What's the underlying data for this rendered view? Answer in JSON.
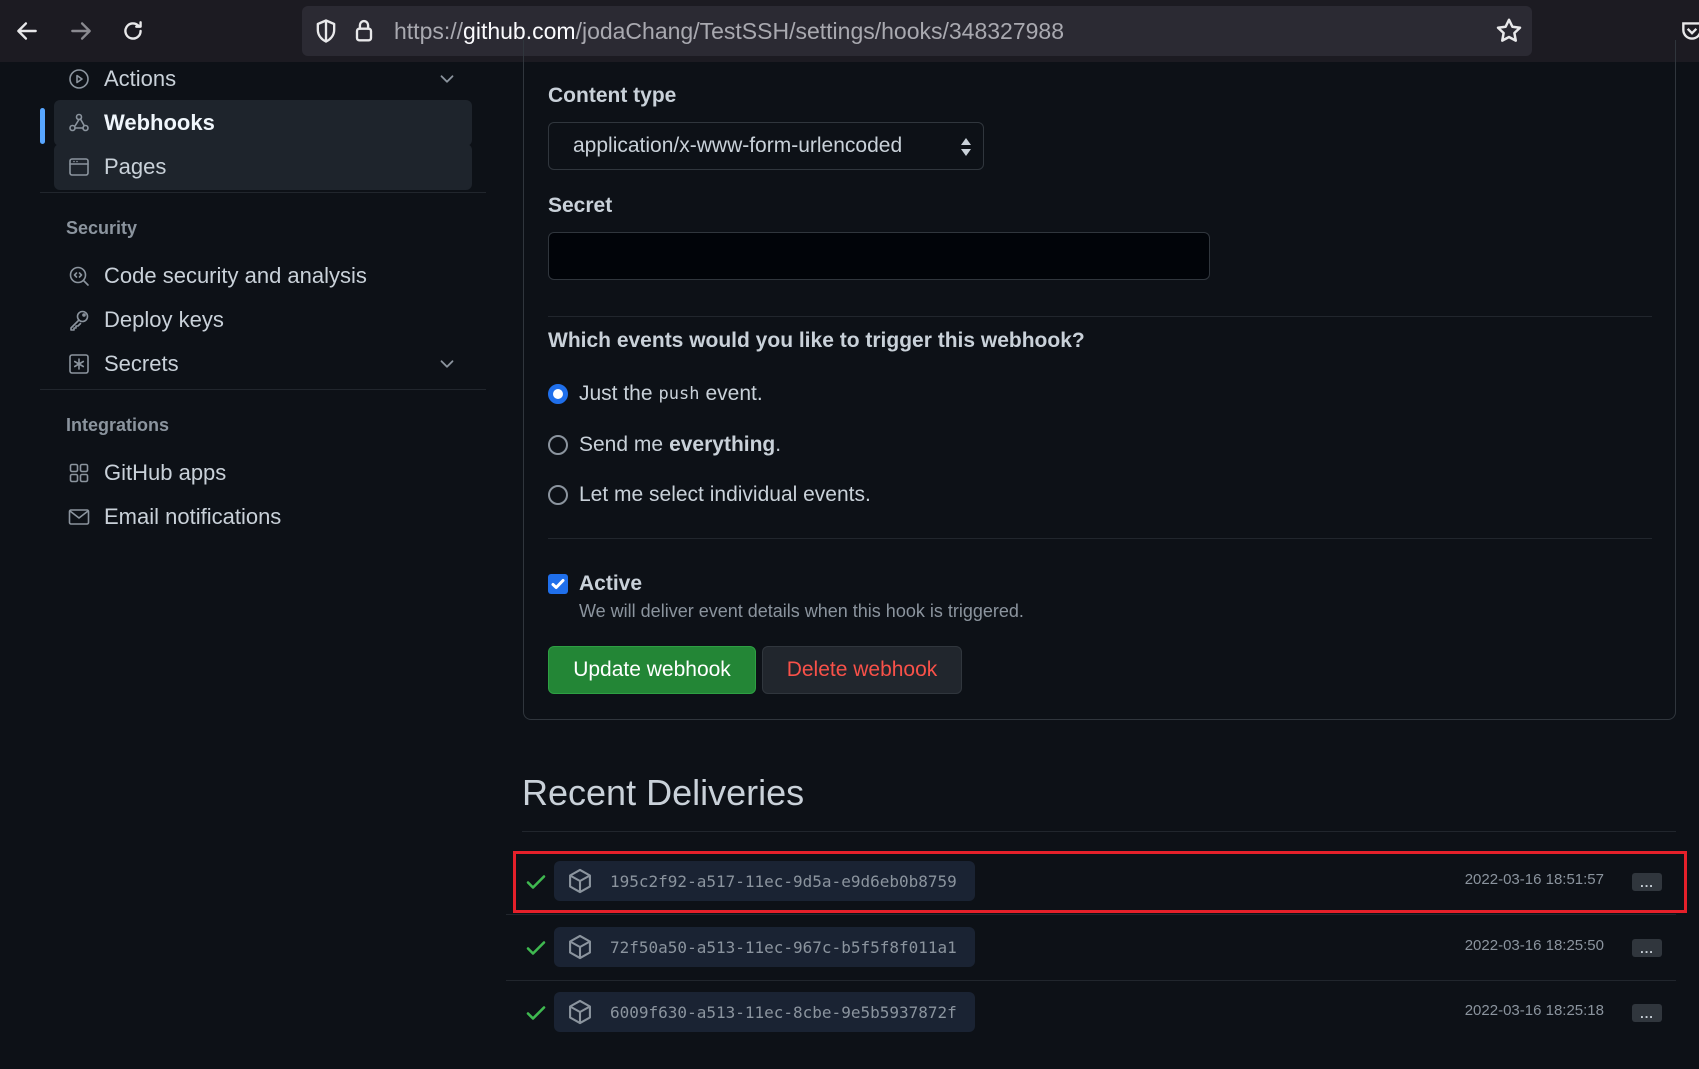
{
  "browser": {
    "url_prefix": "https://",
    "url_host": "github.com",
    "url_path": "/jodaChang/TestSSH/settings/hooks/348327988"
  },
  "sidebar": {
    "items_top": [
      {
        "label": "Actions",
        "icon": "play-circle-icon",
        "has_chevron": true
      },
      {
        "label": "Webhooks",
        "icon": "webhook-icon",
        "active": true
      },
      {
        "label": "Pages",
        "icon": "browser-icon"
      }
    ],
    "security_heading": "Security",
    "security_items": [
      {
        "label": "Code security and analysis",
        "icon": "codescan-icon"
      },
      {
        "label": "Deploy keys",
        "icon": "key-icon"
      },
      {
        "label": "Secrets",
        "icon": "asterisk-box-icon",
        "has_chevron": true
      }
    ],
    "integrations_heading": "Integrations",
    "integrations_items": [
      {
        "label": "GitHub apps",
        "icon": "apps-icon"
      },
      {
        "label": "Email notifications",
        "icon": "mail-icon"
      }
    ]
  },
  "form": {
    "content_type_label": "Content type",
    "content_type_value": "application/x-www-form-urlencoded",
    "secret_label": "Secret",
    "secret_value": "",
    "events_question": "Which events would you like to trigger this webhook?",
    "radio_push_pre": "Just the",
    "radio_push_code": "push",
    "radio_push_post": "event.",
    "radio_everything_pre": "Send me",
    "radio_everything_bold": "everything",
    "radio_everything_post": ".",
    "radio_select": "Let me select individual events.",
    "selected_radio": "push",
    "active_label": "Active",
    "active_checked": true,
    "active_note": "We will deliver event details when this hook is triggered.",
    "update_button": "Update webhook",
    "delete_button": "Delete webhook"
  },
  "recent_deliveries": {
    "title": "Recent Deliveries",
    "items": [
      {
        "guid": "195c2f92-a517-11ec-9d5a-e9d6eb0b8759",
        "time": "2022-03-16 18:51:57",
        "status": "success",
        "highlighted": true
      },
      {
        "guid": "72f50a50-a513-11ec-967c-b5f5f8f011a1",
        "time": "2022-03-16 18:25:50",
        "status": "success"
      },
      {
        "guid": "6009f630-a513-11ec-8cbe-9e5b5937872f",
        "time": "2022-03-16 18:25:18",
        "status": "success"
      }
    ],
    "more_label": "..."
  },
  "colors": {
    "accent": "#58a6ff",
    "primary_button": "#238636",
    "danger_text": "#f85149",
    "success_check": "#3fb950",
    "highlight_box": "#e5202a"
  }
}
